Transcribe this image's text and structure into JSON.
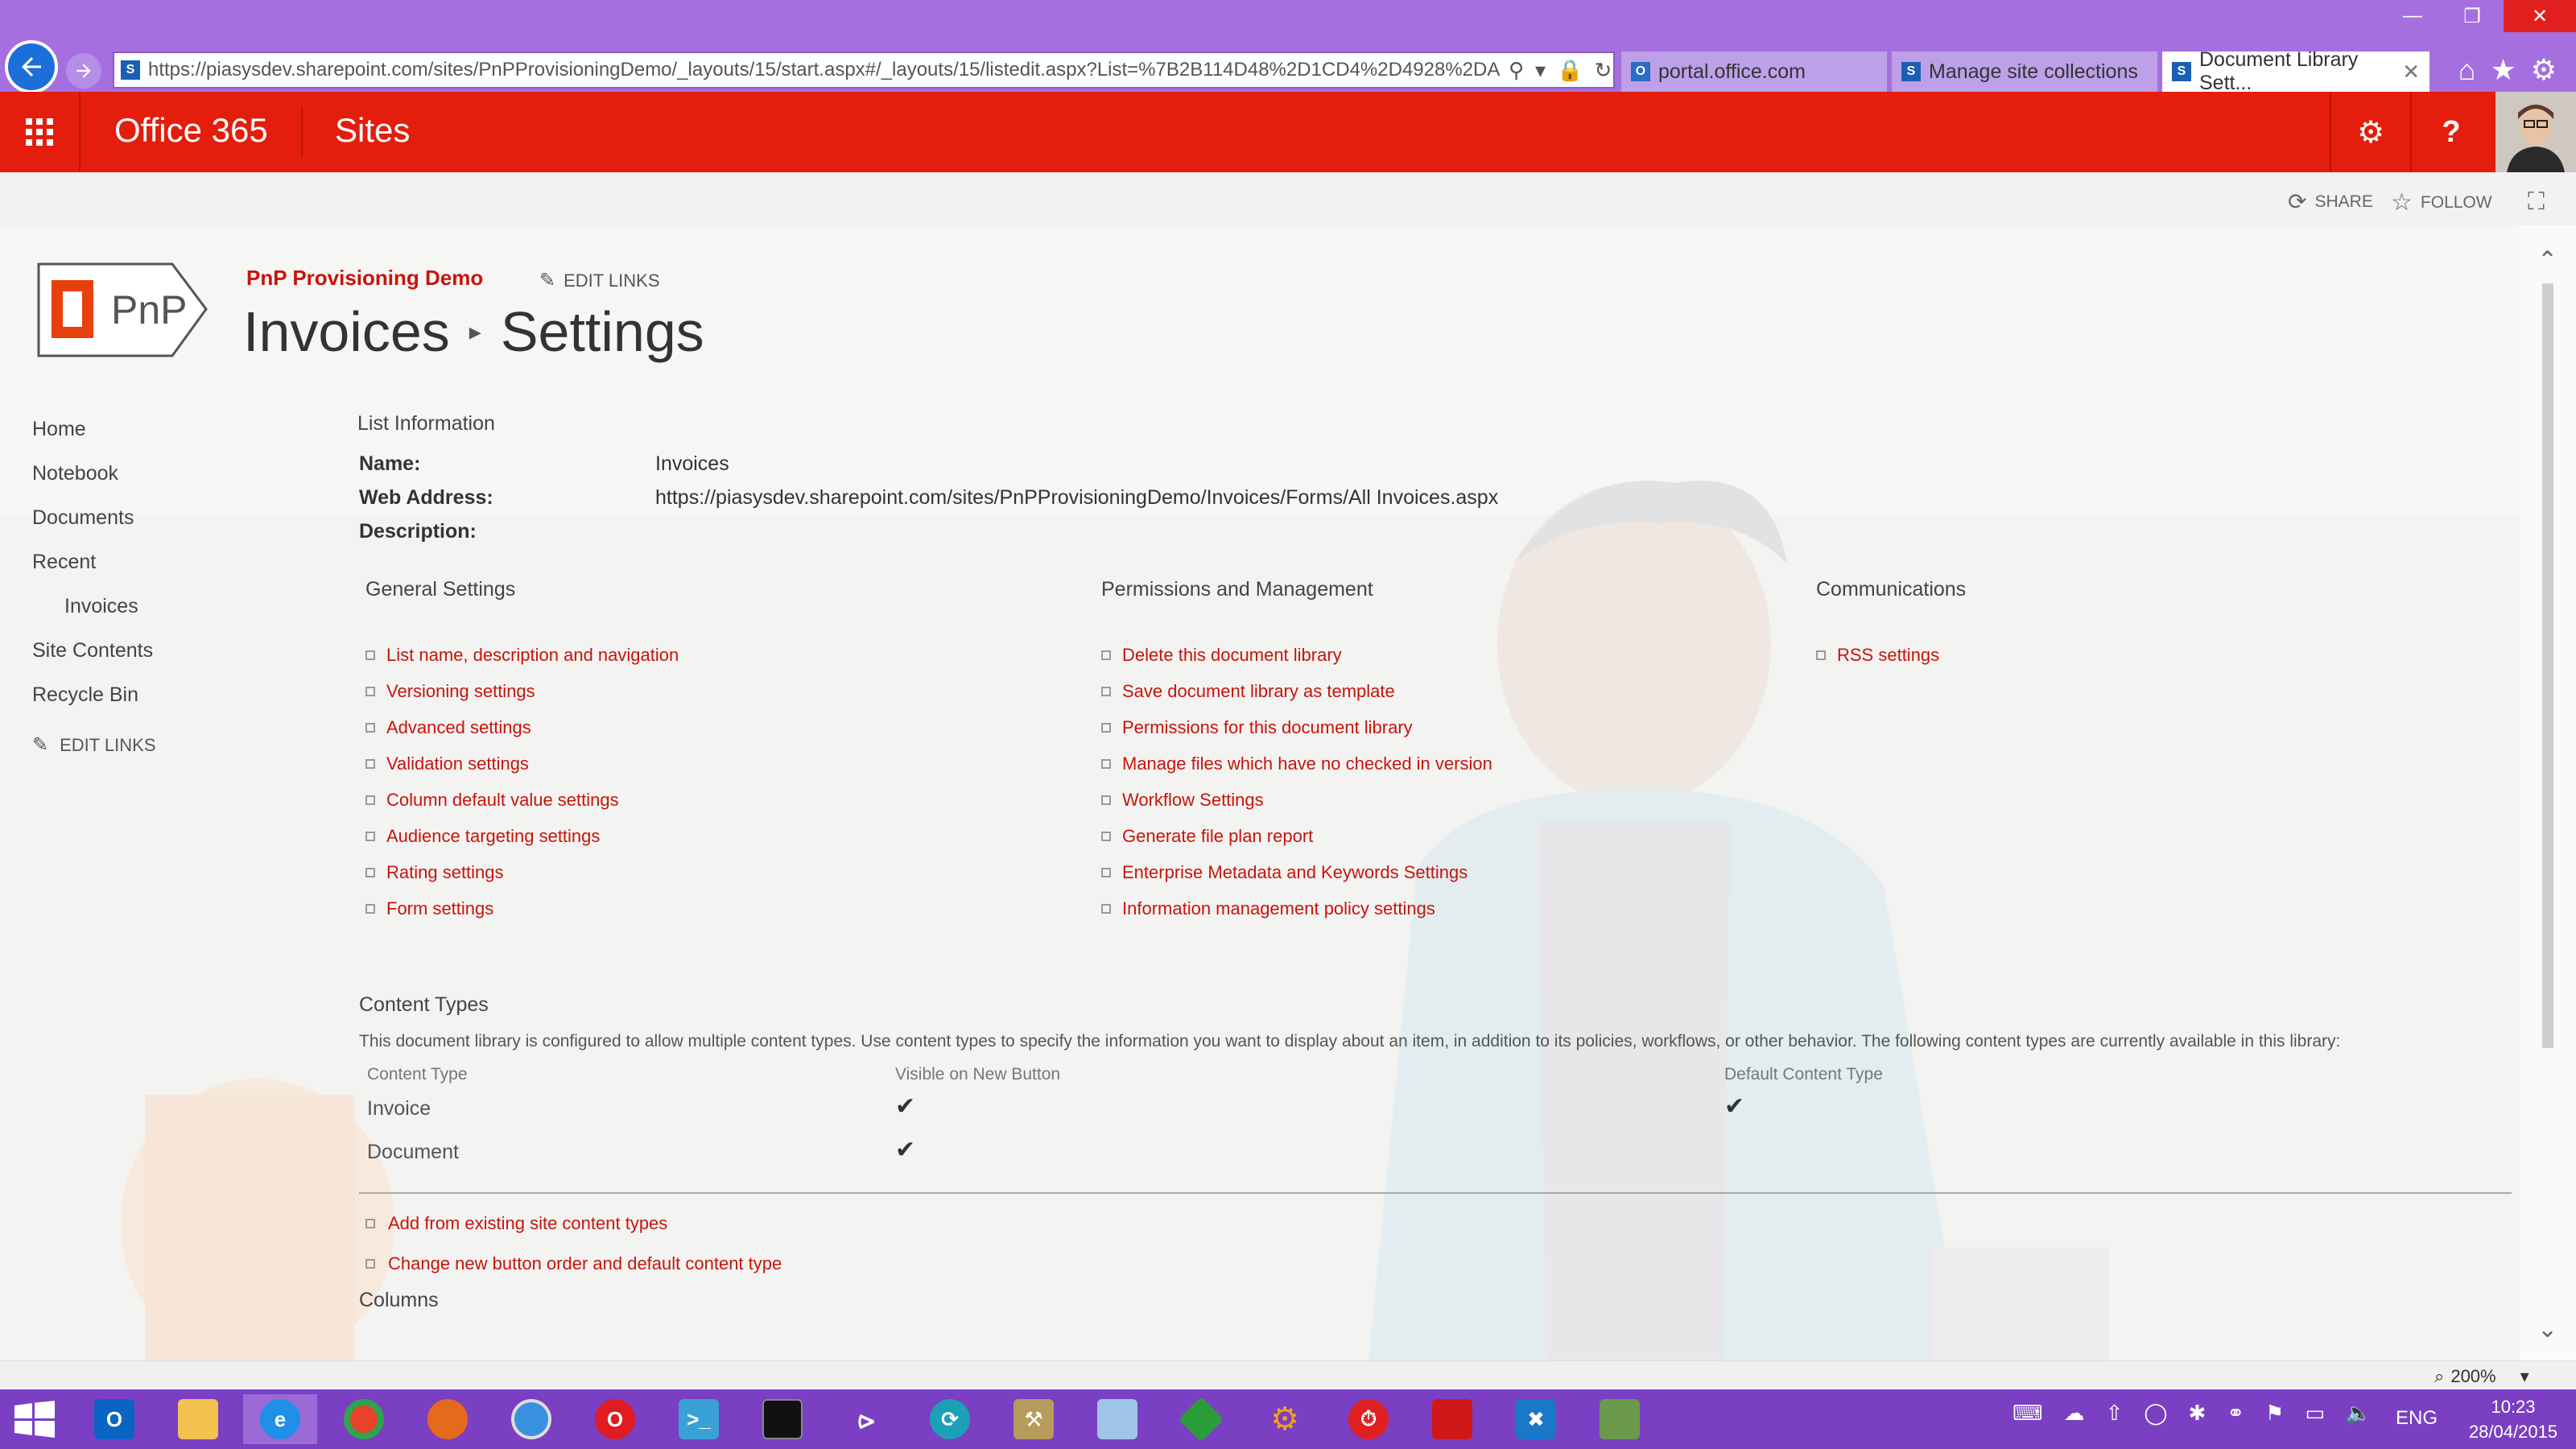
{
  "browser": {
    "url": "https://piasysdev.sharepoint.com/sites/PnPProvisioningDemo/_layouts/15/start.aspx#/_layouts/15/listedit.aspx?List=%7B2B114D48%2D1CD4%2D4928%2DA0BF",
    "tabs": [
      {
        "label": "portal.office.com",
        "active": false
      },
      {
        "label": "Manage site collections",
        "active": false
      },
      {
        "label": "Document Library Sett...",
        "active": true
      }
    ],
    "zoom": "200%"
  },
  "suite_bar": {
    "brand": "Office 365",
    "app": "Sites",
    "color": "#e41d0d"
  },
  "ribbon": {
    "share": "SHARE",
    "follow": "FOLLOW"
  },
  "site": {
    "logo_text": "PnP",
    "title": "PnP Provisioning Demo",
    "edit_links": "EDIT LINKS",
    "breadcrumb": [
      "Invoices",
      "Settings"
    ]
  },
  "quick_launch": {
    "items": [
      {
        "label": "Home"
      },
      {
        "label": "Notebook"
      },
      {
        "label": "Documents"
      },
      {
        "label": "Recent"
      },
      {
        "label": "Invoices"
      },
      {
        "label": "Site Contents"
      },
      {
        "label": "Recycle Bin"
      }
    ],
    "edit_links": "EDIT LINKS"
  },
  "list_info": {
    "title": "List Information",
    "name_label": "Name:",
    "name_value": "Invoices",
    "web_address_label": "Web Address:",
    "web_address_value": "https://piasysdev.sharepoint.com/sites/PnPProvisioningDemo/Invoices/Forms/All Invoices.aspx",
    "description_label": "Description:"
  },
  "general_settings": {
    "title": "General Settings",
    "links": [
      "List name, description and navigation",
      "Versioning settings",
      "Advanced settings",
      "Validation settings",
      "Column default value settings",
      "Audience targeting settings",
      "Rating settings",
      "Form settings"
    ]
  },
  "permissions_management": {
    "title": "Permissions and Management",
    "links": [
      "Delete this document library",
      "Save document library as template",
      "Permissions for this document library",
      "Manage files which have no checked in version",
      "Workflow Settings",
      "Generate file plan report",
      "Enterprise Metadata and Keywords Settings",
      "Information management policy settings"
    ]
  },
  "communications": {
    "title": "Communications",
    "links": [
      "RSS settings"
    ]
  },
  "content_types": {
    "title": "Content Types",
    "description": "This document library is configured to allow multiple content types. Use content types to specify the information you want to display about an item, in addition to its policies, workflows, or other behavior. The following content types are currently available in this library:",
    "headers": [
      "Content Type",
      "Visible on New Button",
      "Default Content Type"
    ],
    "rows": [
      {
        "name": "Invoice",
        "visible": true,
        "default": true
      },
      {
        "name": "Document",
        "visible": true,
        "default": false
      }
    ],
    "links": [
      "Add from existing site content types",
      "Change new button order and default content type"
    ]
  },
  "columns_title": "Columns",
  "taskbar": {
    "language": "ENG",
    "time": "10:23",
    "date": "28/04/2015"
  }
}
